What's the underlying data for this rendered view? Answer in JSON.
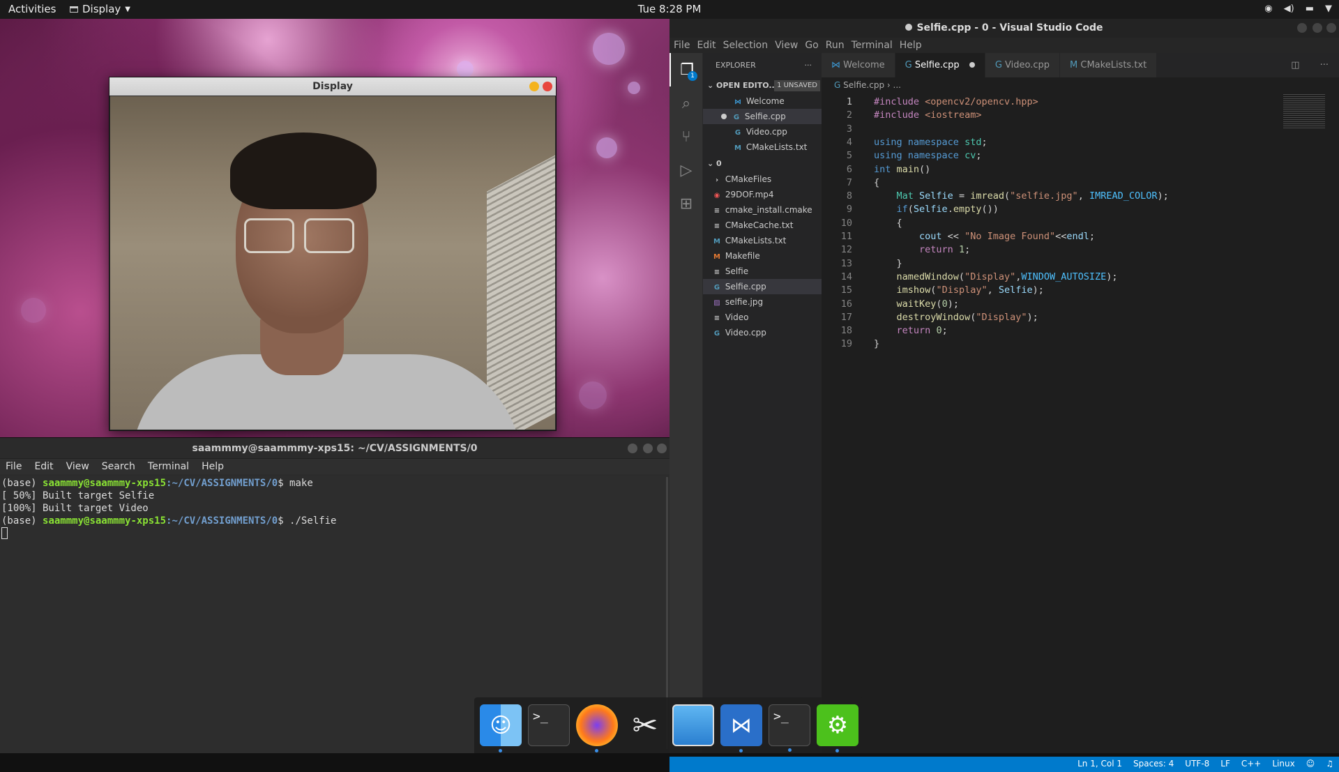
{
  "topbar": {
    "activities": "Activities",
    "app_name": "Display",
    "clock": "Tue  8:28 PM"
  },
  "display_window": {
    "title": "Display"
  },
  "terminal": {
    "title": "saammmy@saammmy-xps15: ~/CV/ASSIGNMENTS/0",
    "menu": [
      "File",
      "Edit",
      "View",
      "Search",
      "Terminal",
      "Help"
    ],
    "lines": [
      {
        "prefix": "(base) ",
        "user": "saammmy@saammmy-xps15",
        "path": ":~/CV/ASSIGNMENTS/0",
        "cmd": "$ make"
      },
      {
        "text": "[ 50%] Built target Selfie"
      },
      {
        "text": "[100%] Built target Video"
      },
      {
        "prefix": "(base) ",
        "user": "saammmy@saammmy-xps15",
        "path": ":~/CV/ASSIGNMENTS/0",
        "cmd": "$ ./Selfie"
      }
    ]
  },
  "vscode": {
    "title": "Selfie.cpp - 0 - Visual Studio Code",
    "menu": [
      "File",
      "Edit",
      "Selection",
      "View",
      "Go",
      "Run",
      "Terminal",
      "Help"
    ],
    "explorer": {
      "header": "EXPLORER",
      "open_editors": "OPEN EDITO...",
      "unsaved": "1 UNSAVED",
      "open_files": [
        "Welcome",
        "Selfie.cpp",
        "Video.cpp",
        "CMakeLists.txt"
      ],
      "folder": "0",
      "files": [
        "CMakeFiles",
        "29DOF.mp4",
        "cmake_install.cmake",
        "CMakeCache.txt",
        "CMakeLists.txt",
        "Makefile",
        "Selfie",
        "Selfie.cpp",
        "selfie.jpg",
        "Video",
        "Video.cpp"
      ]
    },
    "tabs": [
      "Welcome",
      "Selfie.cpp",
      "Video.cpp",
      "CMakeLists.txt"
    ],
    "breadcrumb": "Selfie.cpp",
    "breadcrumb_more": "...",
    "code": [
      "#include <opencv2/opencv.hpp>",
      "#include <iostream>",
      "",
      "using namespace std;",
      "using namespace cv;",
      "int main()",
      "{",
      "    Mat Selfie = imread(\"selfie.jpg\", IMREAD_COLOR);",
      "    if(Selfie.empty())",
      "    {",
      "        cout << \"No Image Found\"<<endl;",
      "        return 1;",
      "    }",
      "    namedWindow(\"Display\",WINDOW_AUTOSIZE);",
      "    imshow(\"Display\", Selfie);",
      "    waitKey(0);",
      "    destroyWindow(\"Display\");",
      "    return 0;",
      "}"
    ],
    "status": {
      "position": "Ln 1, Col 1",
      "spaces": "Spaces: 4",
      "encoding": "UTF-8",
      "eol": "LF",
      "lang": "C++",
      "os": "Linux"
    },
    "badge": "1"
  },
  "colors": {
    "accent": "#007acc",
    "terminal_green": "#8ae234",
    "terminal_blue": "#729fcf"
  }
}
